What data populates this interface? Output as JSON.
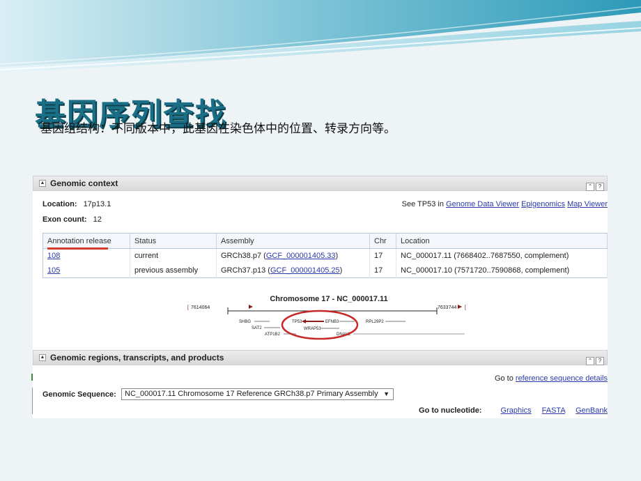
{
  "slide": {
    "title": "基因序列查找",
    "subtitle": "基因组结构：不同版本中，此基因在染色体中的位置、转录方向等。"
  },
  "genomic_context": {
    "header": "Genomic context",
    "location_label": "Location:",
    "location_value": "17p13.1",
    "exon_label": "Exon count:",
    "exon_value": "12",
    "see_prefix": "See TP53 in",
    "see_links": [
      "Genome Data Viewer",
      "Epigenomics",
      "Map Viewer"
    ],
    "columns": [
      "Annotation release",
      "Status",
      "Assembly",
      "Chr",
      "Location"
    ],
    "rows": [
      {
        "release": "108",
        "status": "current",
        "assembly": "GRCh38.p7",
        "assembly_acc": "GCF_000001405.33",
        "chr": "17",
        "location": "NC_000017.11 (7668402..7687550, complement)"
      },
      {
        "release": "105",
        "status": "previous assembly",
        "assembly": "GRCh37.p13",
        "assembly_acc": "GCF_000001405.25",
        "chr": "17",
        "location": "NC_000017.10 (7571720..7590868, complement)"
      }
    ],
    "diagram": {
      "title": "Chromosome 17 - NC_000017.11",
      "left_coord": "7614064",
      "right_coord": "7633744",
      "genes": [
        "SHBG",
        "SAT2",
        "ATP1B2",
        "TP53",
        "EFNB3",
        "WRAP53",
        "DNAH2",
        "RPL29P2"
      ]
    }
  },
  "genomic_regions": {
    "header": "Genomic regions, transcripts, and products",
    "goto_prefix": "Go to",
    "goto_link": "reference sequence details",
    "seq_label": "Genomic Sequence:",
    "seq_value": "NC_000017.11 Chromosome 17 Reference GRCh38.p7 Primary Assembly",
    "nuc_label": "Go to nucleotide:",
    "nuc_links": [
      "Graphics",
      "FASTA",
      "GenBank"
    ]
  },
  "colors": {
    "title": "#1a6e85",
    "link": "#2a3aa8",
    "highlight": "#d43a2a"
  }
}
